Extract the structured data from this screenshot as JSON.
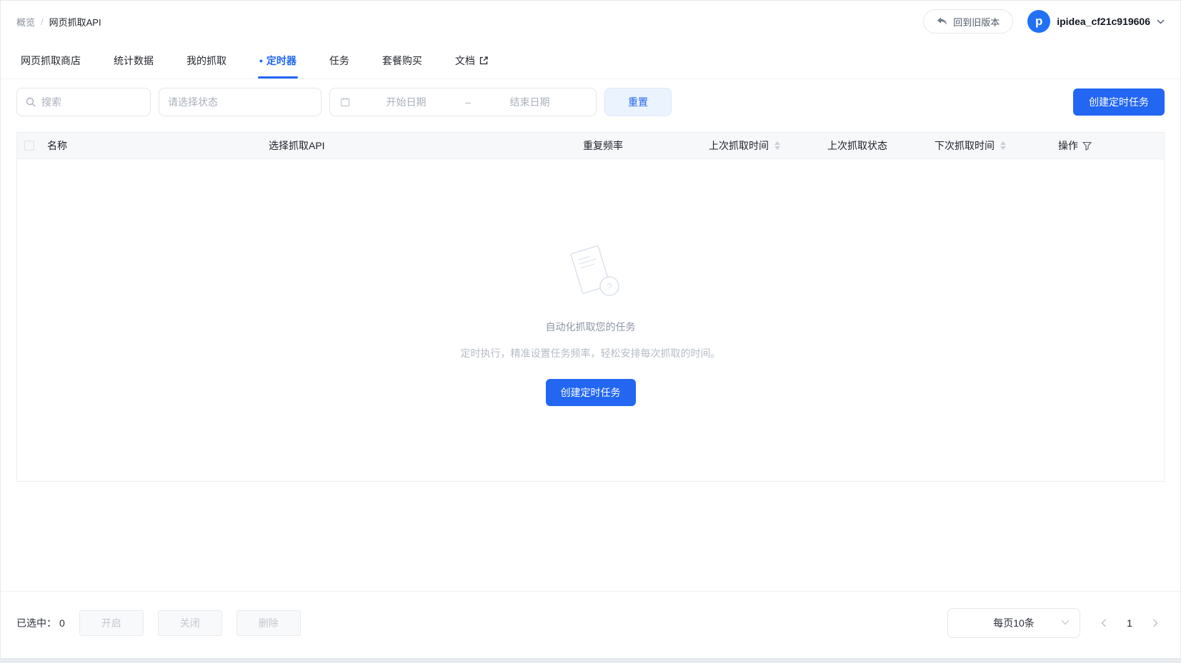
{
  "header": {
    "breadcrumb": {
      "root": "概览",
      "separator": "/",
      "current": "网页抓取API"
    },
    "back_button_label": "回到旧版本",
    "account_name": "ipidea_cf21c919606",
    "avatar_letter": "p"
  },
  "tabs": {
    "active_dot": "•",
    "items": [
      {
        "label": "网页抓取商店",
        "active": false
      },
      {
        "label": "统计数据",
        "active": false
      },
      {
        "label": "我的抓取",
        "active": false
      },
      {
        "label": "定时器",
        "active": true
      },
      {
        "label": "任务",
        "active": false
      },
      {
        "label": "套餐购买",
        "active": false
      },
      {
        "label": "文档",
        "active": false
      }
    ]
  },
  "filters": {
    "search_placeholder": "搜索",
    "status_placeholder": "请选择状态",
    "date_start_placeholder": "开始日期",
    "date_separator": "–",
    "date_end_placeholder": "结束日期",
    "reset_label": "重置",
    "create_label": "创建定时任务"
  },
  "table": {
    "columns": [
      "名称",
      "选择抓取API",
      "重复频率",
      "上次抓取时间",
      "上次抓取状态",
      "下次抓取时间",
      "操作"
    ],
    "rows": [],
    "empty": {
      "title": "自动化抓取您的任务",
      "description": "定时执行，精准设置任务频率，轻松安排每次抓取的时间。",
      "create_label": "创建定时任务",
      "question_mark": "?"
    }
  },
  "footer": {
    "selected_label": "已选中：",
    "selected_count": "0",
    "enable_label": "开启",
    "disable_label": "关闭",
    "delete_label": "删除",
    "page_size": "每页10条",
    "current_page": "1"
  },
  "colors": {
    "primary_blue": "#2266f2",
    "reset_bg": "#ebf3fe",
    "avatar_blue": "#2271f5",
    "header_bg": "#f7f8fa",
    "border": "#e5e6eb",
    "placeholder": "#a9b0bc",
    "empty_illustration_stroke": "#d9dfeb"
  }
}
